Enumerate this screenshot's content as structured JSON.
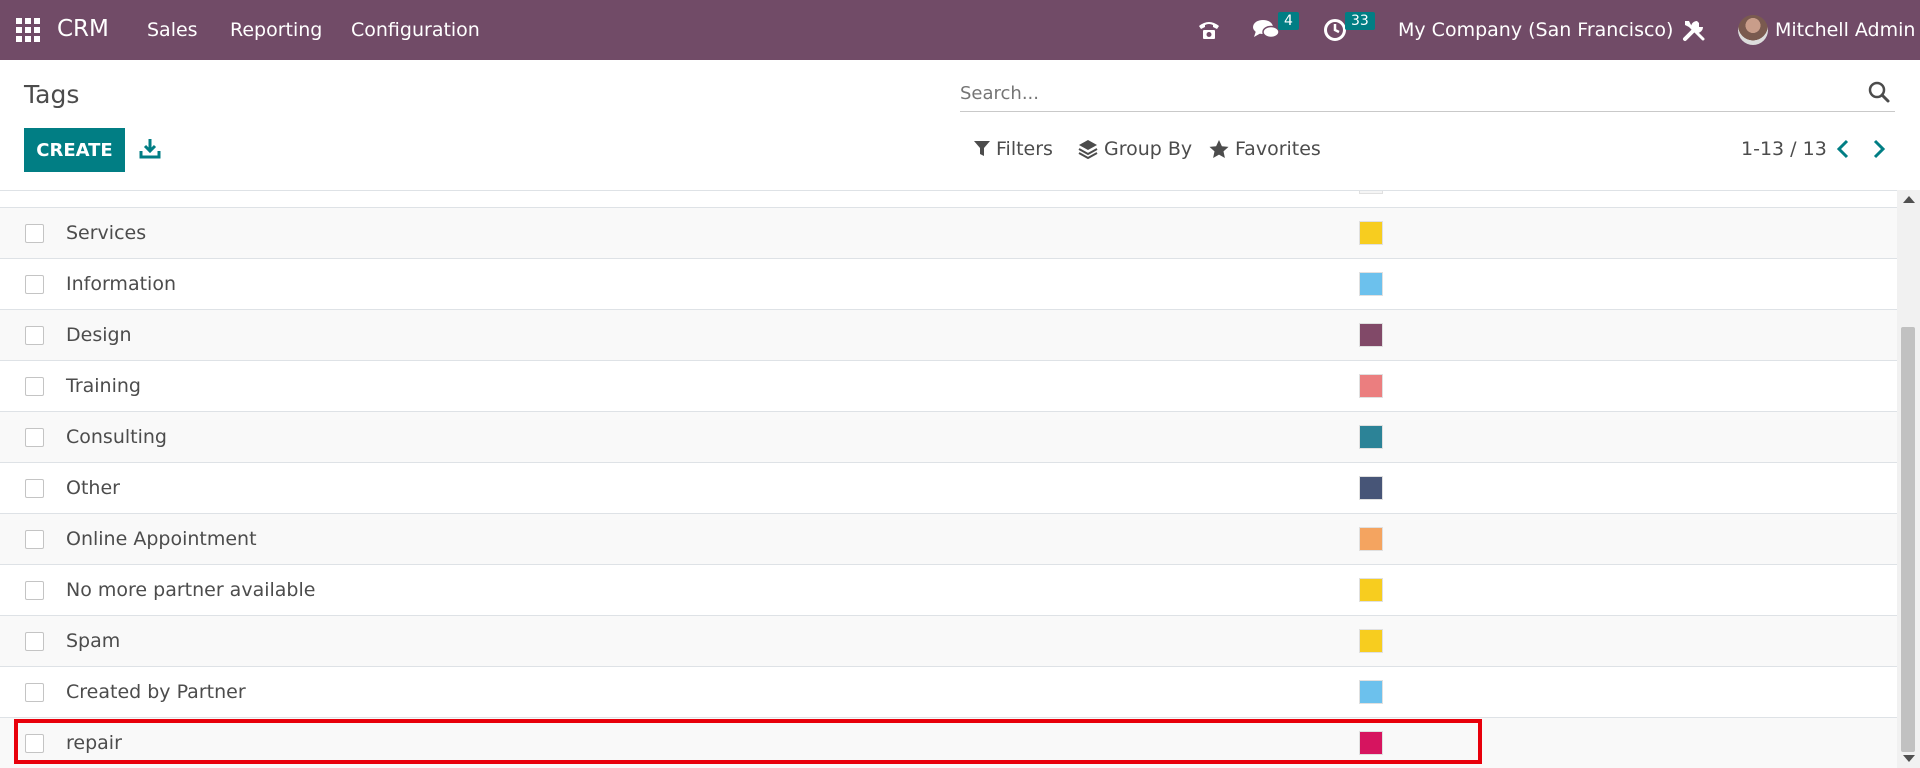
{
  "navbar": {
    "brand": "CRM",
    "menu": [
      "Sales",
      "Reporting",
      "Configuration"
    ],
    "messages_count": "4",
    "activities_count": "33",
    "company": "My Company (San Francisco)",
    "user": "Mitchell Admin"
  },
  "page": {
    "title": "Tags"
  },
  "search": {
    "placeholder": "Search..."
  },
  "toolbar": {
    "create_label": "CREATE",
    "filters_label": "Filters",
    "group_by_label": "Group By",
    "favorites_label": "Favorites",
    "pager": "1-13 / 13"
  },
  "list": {
    "rows": [
      {
        "name": "Services",
        "color": "#f7cd1f"
      },
      {
        "name": "Information",
        "color": "#6cc1ed"
      },
      {
        "name": "Design",
        "color": "#814968"
      },
      {
        "name": "Training",
        "color": "#eb7e7f"
      },
      {
        "name": "Consulting",
        "color": "#2c8397"
      },
      {
        "name": "Other",
        "color": "#475577"
      },
      {
        "name": "Online Appointment",
        "color": "#f4a460"
      },
      {
        "name": "No more partner available",
        "color": "#f7cd1f"
      },
      {
        "name": "Spam",
        "color": "#f7cd1f"
      },
      {
        "name": "Created by Partner",
        "color": "#6cc1ed"
      },
      {
        "name": "repair",
        "color": "#d6145f"
      }
    ]
  },
  "colors": {
    "navbar": "#714b67",
    "primary": "#017e84",
    "highlight": "#e8000b"
  }
}
